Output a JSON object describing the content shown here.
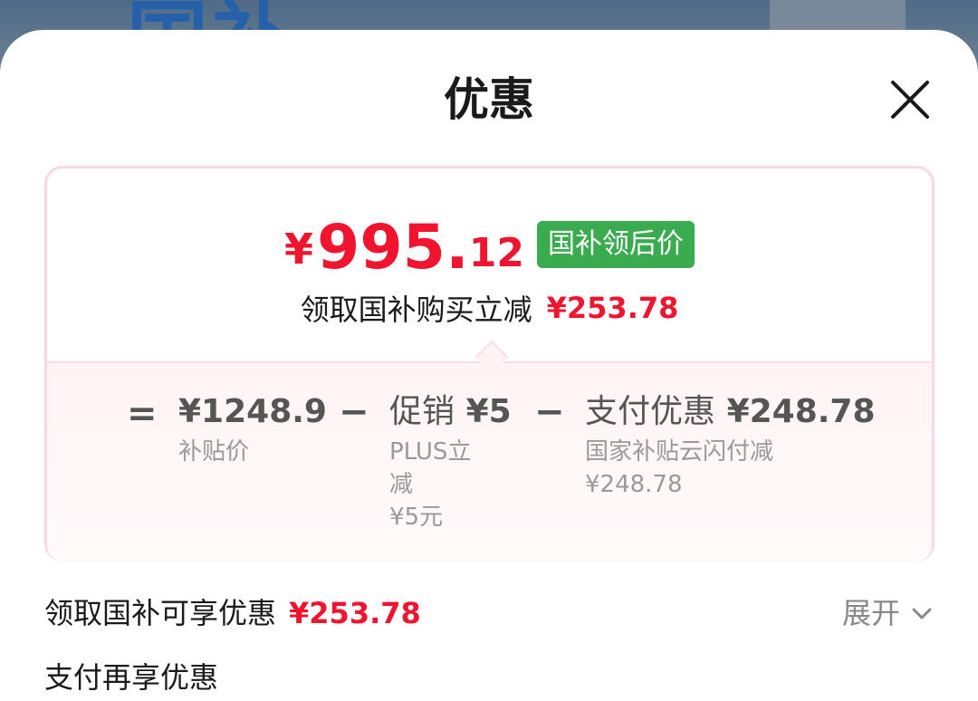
{
  "sheet": {
    "title": "优惠"
  },
  "summary": {
    "currency": "¥",
    "price_integer": "995.",
    "price_decimal": "12",
    "badge": "国补领后价",
    "subtitle": "领取国补购买立减",
    "subtitle_amount": "¥253.78"
  },
  "breakdown": {
    "equals_sign": "=",
    "minus_sign": "−",
    "base_price": {
      "value": "¥1248.9",
      "label": "补贴价"
    },
    "promo": {
      "label": "促销",
      "value": "¥5",
      "desc_line1": "PLUS立",
      "desc_line2": "减",
      "desc_line3": "¥5元"
    },
    "payment": {
      "label": "支付优惠",
      "value": "¥248.78",
      "desc_line1": "国家补贴云闪付减",
      "desc_line2": "¥248.78"
    }
  },
  "lines": {
    "subsidy_label": "领取国补可享优惠",
    "subsidy_amount": "¥253.78",
    "expand_label": "展开",
    "payment_label": "支付再享优惠"
  },
  "colors": {
    "price_red": "#f0142e",
    "badge_green": "#3aab4f",
    "card_border": "#f8d9e3",
    "card_tint": "#fff3f5"
  },
  "icons": {
    "close": "close-icon",
    "expand": "chevron-down-icon"
  }
}
